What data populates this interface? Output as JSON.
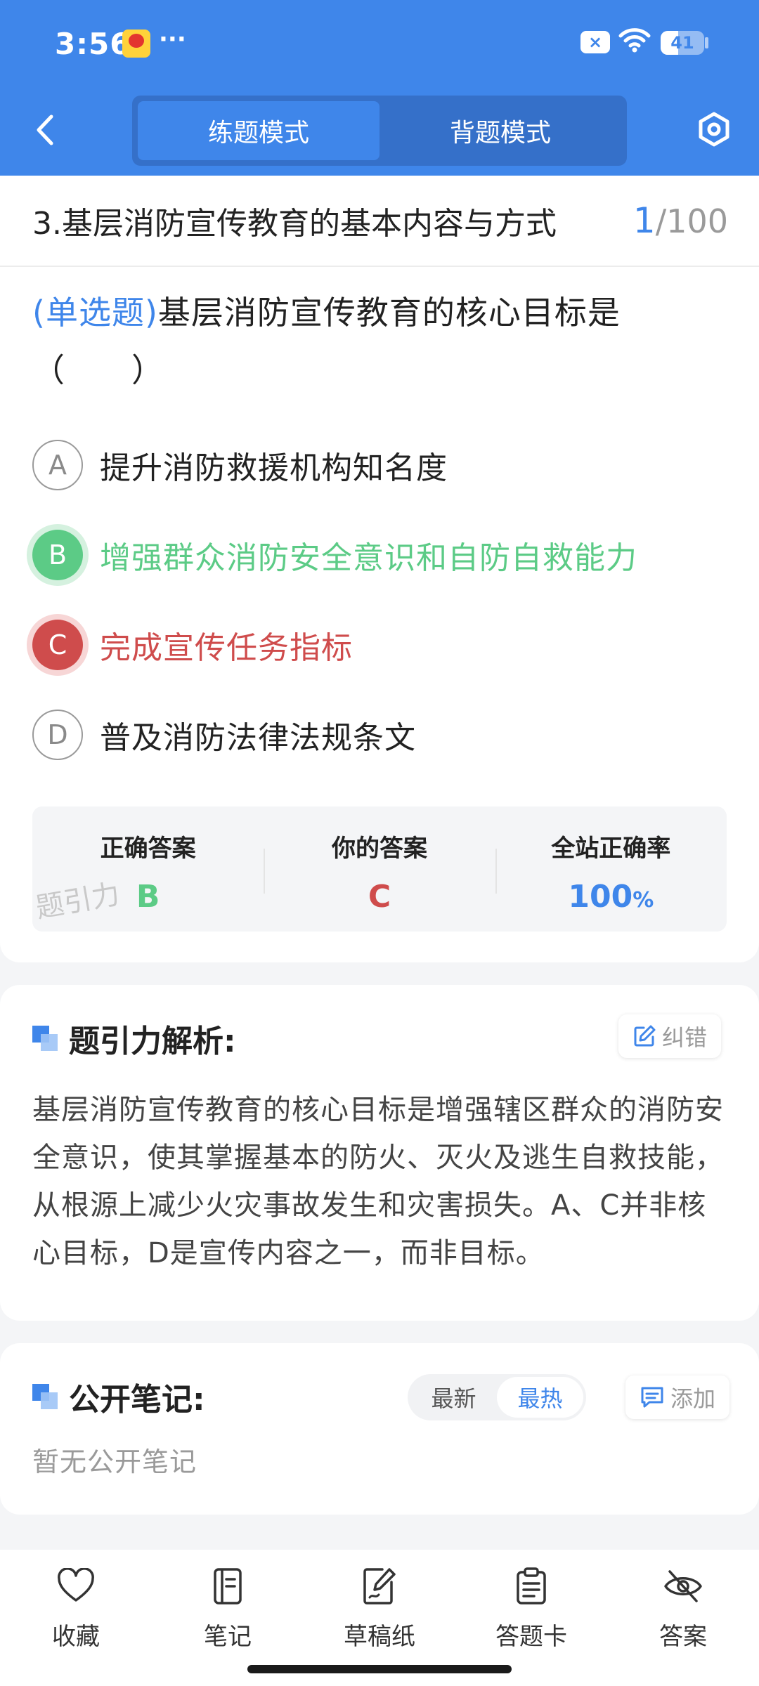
{
  "status_bar": {
    "time": "3:56",
    "more": "···",
    "battery": "41",
    "battery_level": 0.41
  },
  "header": {
    "tabs": [
      {
        "label": "练题模式",
        "active": true
      },
      {
        "label": "背题模式",
        "active": false
      }
    ],
    "back_icon": "chevron-left-icon",
    "settings_icon": "hexagon-settings-icon",
    "colors": {
      "primary": "#3f86ea",
      "switch_bg": "#3570c9"
    }
  },
  "question": {
    "section_title": "3.基层消防宣传教育的基本内容与方式",
    "index": "1",
    "total": "/100",
    "type": "(单选题)",
    "text": "基层消防宣传教育的核心目标是（　　）",
    "options": [
      {
        "letter": "A",
        "text": "提升消防救援机构知名度",
        "state": "normal"
      },
      {
        "letter": "B",
        "text": "增强群众消防安全意识和自防自救能力",
        "state": "correct"
      },
      {
        "letter": "C",
        "text": "完成宣传任务指标",
        "state": "wrong"
      },
      {
        "letter": "D",
        "text": "普及消防法律法规条文",
        "state": "normal"
      }
    ],
    "colors": {
      "correct": "#5ccb86",
      "wrong": "#cf4c4c"
    }
  },
  "answer_summary": {
    "correct_label": "正确答案",
    "correct_value": "B",
    "yours_label": "你的答案",
    "yours_value": "C",
    "rate_label": "全站正确率",
    "rate_value": "100",
    "rate_unit": "%",
    "watermark": "题引力"
  },
  "analysis": {
    "title": "题引力解析:",
    "correction_button": "纠错",
    "text": "基层消防宣传教育的核心目标是增强辖区群众的消防安全意识，使其掌握基本的防火、灭火及逃生自救技能，从根源上减少火灾事故发生和灾害损失。A、C并非核心目标，D是宣传内容之一，而非目标。"
  },
  "notes": {
    "title": "公开笔记:",
    "sort_options": [
      {
        "label": "最新",
        "active": false
      },
      {
        "label": "最热",
        "active": true
      }
    ],
    "add_button": "添加",
    "empty_text": "暂无公开笔记"
  },
  "bottom_nav": [
    {
      "label": "收藏",
      "icon": "heart-icon"
    },
    {
      "label": "笔记",
      "icon": "notebook-icon"
    },
    {
      "label": "草稿纸",
      "icon": "draft-paper-icon"
    },
    {
      "label": "答题卡",
      "icon": "answer-sheet-icon"
    },
    {
      "label": "答案",
      "icon": "eye-off-icon"
    }
  ]
}
